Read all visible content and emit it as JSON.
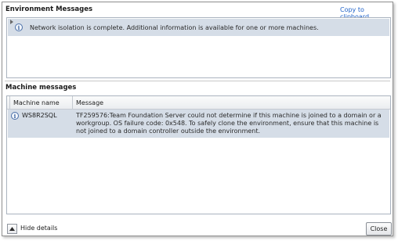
{
  "environment": {
    "title": "Environment Messages",
    "copy_link": "Copy to clipboard",
    "message": "Network isolation is complete. Additional information is available for one or more machines."
  },
  "machine": {
    "title": "Machine messages",
    "columns": [
      "Machine name",
      "Message"
    ],
    "rows": [
      {
        "name": "WS8R2SQL",
        "message": "TF259576:Team Foundation Server could not determine if this machine is joined to a domain or a workgroup. OS failure code: 0x548. To safely clone the environment, ensure that this machine is not joined to a domain controller outside the environment."
      }
    ]
  },
  "footer": {
    "hide_details": "Hide details",
    "close": "Close"
  },
  "icons": {
    "info": "info-icon",
    "expander": "chevron-right-icon",
    "hide": "chevron-up-icon"
  },
  "colors": {
    "selection": "#d5dde7",
    "link": "#1f62c8"
  }
}
